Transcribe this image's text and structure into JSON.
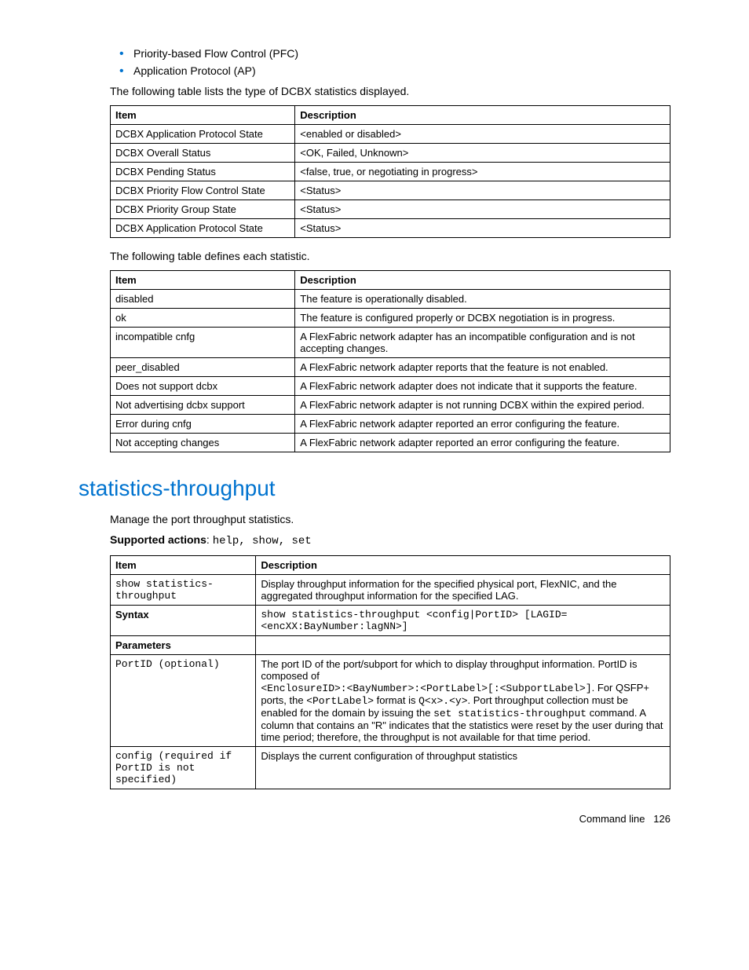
{
  "bullets": [
    "Priority-based Flow Control (PFC)",
    "Application Protocol (AP)"
  ],
  "intro1": "The following table lists the type of DCBX statistics displayed.",
  "table1": {
    "headers": [
      "Item",
      "Description"
    ],
    "rows": [
      [
        "DCBX Application Protocol State",
        "<enabled or disabled>"
      ],
      [
        "DCBX Overall Status",
        "<OK, Failed, Unknown>"
      ],
      [
        "DCBX Pending Status",
        "<false, true, or negotiating in progress>"
      ],
      [
        "DCBX Priority Flow Control State",
        "<Status>"
      ],
      [
        "DCBX Priority Group State",
        "<Status>"
      ],
      [
        "DCBX Application Protocol State",
        "<Status>"
      ]
    ]
  },
  "intro2": "The following table defines each statistic.",
  "table2": {
    "headers": [
      "Item",
      "Description"
    ],
    "rows": [
      [
        "disabled",
        "The feature is operationally disabled."
      ],
      [
        "ok",
        "The feature is configured properly or DCBX negotiation is in progress."
      ],
      [
        "incompatible cnfg",
        "A FlexFabric network adapter has an incompatible configuration and is not accepting changes."
      ],
      [
        "peer_disabled",
        "A FlexFabric network adapter reports that the feature is not enabled."
      ],
      [
        "Does not support dcbx",
        "A FlexFabric network adapter does not indicate that it supports the feature."
      ],
      [
        "Not advertising dcbx support",
        "A FlexFabric network adapter is not running DCBX within the expired period."
      ],
      [
        "Error during cnfg",
        "A FlexFabric network adapter reported an error configuring the feature."
      ],
      [
        "Not accepting changes",
        "A FlexFabric network adapter reported an error configuring the feature."
      ]
    ]
  },
  "section": {
    "heading": "statistics-throughput",
    "intro": "Manage the port throughput statistics.",
    "supported_label": "Supported actions",
    "supported_actions": "help, show, set"
  },
  "table3": {
    "headers": [
      "Item",
      "Description"
    ],
    "row1_item": "show statistics-throughput",
    "row1_desc": "Display throughput information for the specified physical port, FlexNIC, and the aggregated throughput information for the specified LAG.",
    "row2_item": "Syntax",
    "row2_desc": "show statistics-throughput <config|PortID> [LAGID=<encXX:BayNumber:lagNN>]",
    "row3_item": "Parameters",
    "row4_item": "PortID (optional)",
    "row4_desc_1": "The port ID of the port/subport for which to display throughput information. PortID is composed of",
    "row4_desc_2a": "<EnclosureID>:<BayNumber>:<PortLabel>[:<SubportLabel>]",
    "row4_desc_2b": ". For QSFP+ ports, the ",
    "row4_desc_2c": "<PortLabel>",
    "row4_desc_2d": " format is ",
    "row4_desc_2e": "Q<x>.<y>",
    "row4_desc_2f": ". Port throughput collection must be enabled for the domain by issuing the ",
    "row4_desc_2g": "set statistics-throughput",
    "row4_desc_2h": " command. A column that contains an \"R\" indicates that the statistics were reset by the user during that time period; therefore, the throughput is not available for that time period.",
    "row5_item": "config (required if PortID is not specified)",
    "row5_desc": "Displays the current configuration of throughput statistics"
  },
  "footer": {
    "label": "Command line",
    "page": "126"
  }
}
